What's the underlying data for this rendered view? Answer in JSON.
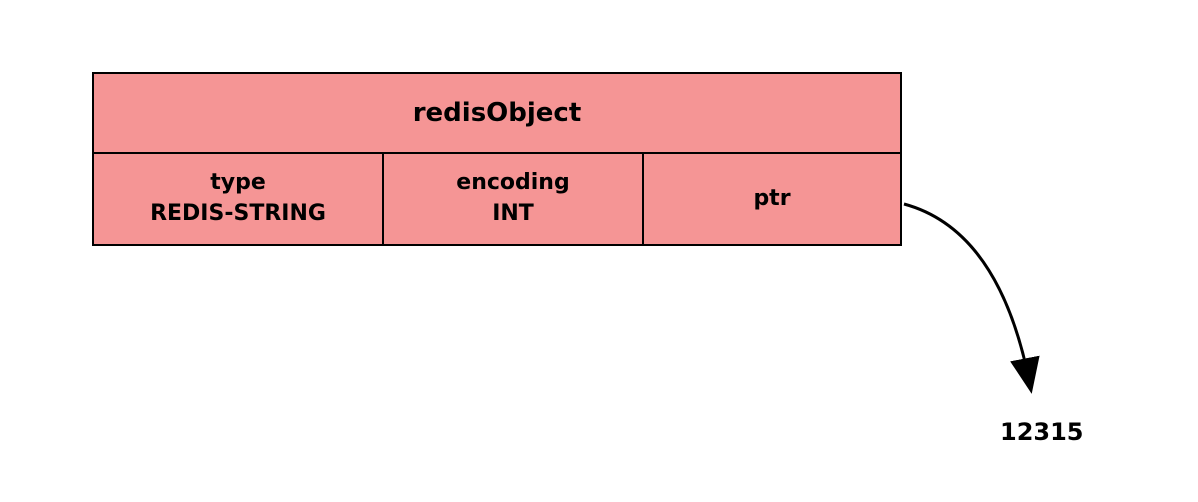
{
  "struct": {
    "title": "redisObject",
    "fields": {
      "type": {
        "label": "type",
        "value": "REDIS-STRING"
      },
      "encoding": {
        "label": "encoding",
        "value": "INT"
      },
      "ptr": {
        "label": "ptr"
      }
    }
  },
  "pointer_target": "12315"
}
